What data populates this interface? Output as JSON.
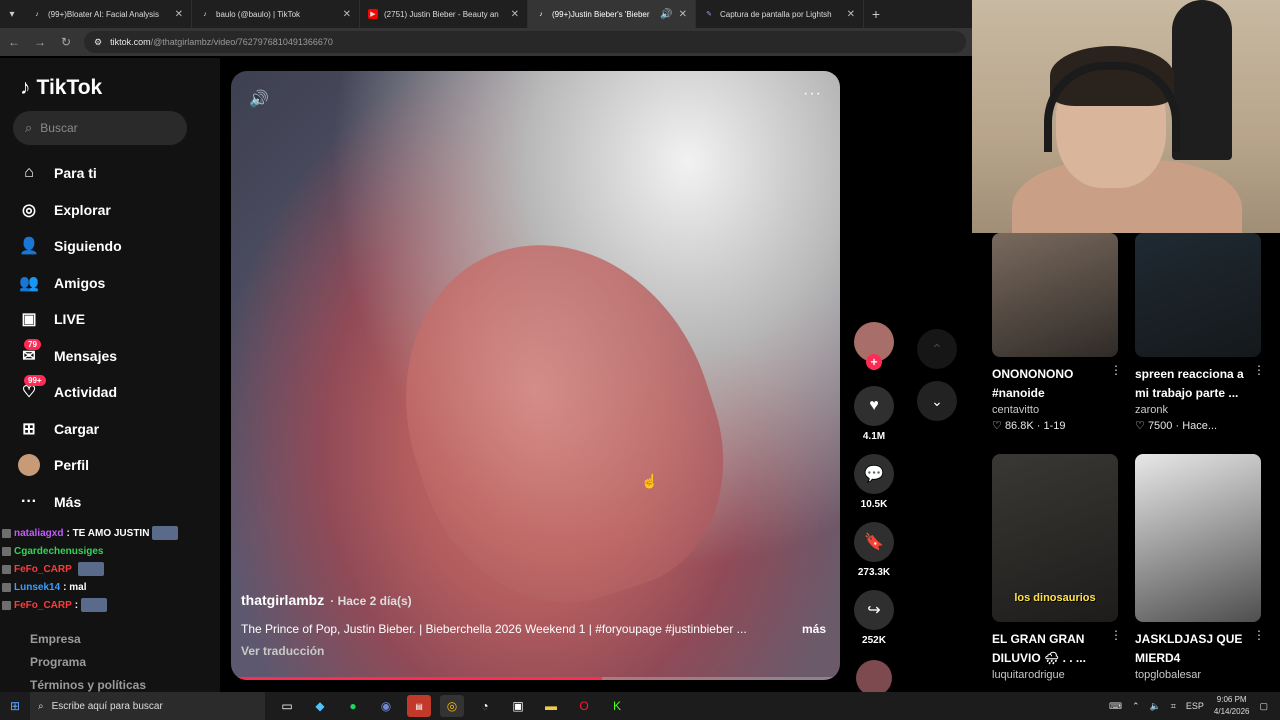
{
  "browser": {
    "tabs": [
      {
        "title": "(99+)Bloater AI: Facial Analysis",
        "favicon": "tiktok-icon",
        "active": false
      },
      {
        "title": "baulo (@baulo) | TikTok",
        "favicon": "tiktok-icon",
        "active": false
      },
      {
        "title": "(2751) Justin Bieber - Beauty an",
        "favicon": "youtube-icon",
        "active": false
      },
      {
        "title": "(99+)Justin Bieber's 'Bieber",
        "favicon": "tiktok-icon",
        "active": true
      },
      {
        "title": "Captura de pantalla por Lightsh",
        "favicon": "lightshot-icon",
        "active": false
      }
    ],
    "url_host": "tiktok.com",
    "url_path": "/@thatgirlambz/video/7627976810491366670"
  },
  "sidebar": {
    "logo": "TikTok",
    "search_placeholder": "Buscar",
    "nav": [
      {
        "label": "Para ti",
        "icon": "home-icon",
        "glyph": "⌂",
        "badge": ""
      },
      {
        "label": "Explorar",
        "icon": "compass-icon",
        "glyph": "◎",
        "badge": ""
      },
      {
        "label": "Siguiendo",
        "icon": "following-icon",
        "glyph": "👤",
        "badge": ""
      },
      {
        "label": "Amigos",
        "icon": "friends-icon",
        "glyph": "👥",
        "badge": ""
      },
      {
        "label": "LIVE",
        "icon": "live-icon",
        "glyph": "▣",
        "badge": ""
      },
      {
        "label": "Mensajes",
        "icon": "messages-icon",
        "glyph": "✉",
        "badge": "79"
      },
      {
        "label": "Actividad",
        "icon": "activity-icon",
        "glyph": "♡",
        "badge": "99+"
      },
      {
        "label": "Cargar",
        "icon": "upload-icon",
        "glyph": "⊞",
        "badge": ""
      },
      {
        "label": "Perfil",
        "icon": "profile-avatar",
        "glyph": "",
        "badge": ""
      },
      {
        "label": "Más",
        "icon": "more-icon",
        "glyph": "···",
        "badge": ""
      }
    ],
    "footer": [
      "Empresa",
      "Programa",
      "Términos y políticas"
    ]
  },
  "stream_chat": [
    {
      "user": "nataliagxd",
      "message": ": TE AMO JUSTIN"
    },
    {
      "user": "Cgardechenusiges",
      "message": ""
    },
    {
      "user": "FeFo_CARP",
      "message": ""
    },
    {
      "user": "Lunsek14",
      "message": ": mal"
    },
    {
      "user": "FeFo_CARP",
      "message": ":"
    }
  ],
  "video": {
    "author": "thatgirlambz",
    "posted": "Hace 2 día(s)",
    "description": "The Prince of Pop, Justin Bieber. | Bieberchella 2026 Weekend 1 | #foryoupage #justinbieber ...",
    "more_label": "más",
    "translate_label": "Ver traducción",
    "progress": 0.61,
    "likes": "4.1M",
    "comments": "10.5K",
    "saves": "273.3K",
    "shares": "252K"
  },
  "recommended": [
    {
      "title": "ONONONONO #nanoide",
      "author": "centavitto",
      "likes": "86.8K",
      "extra": "1-19",
      "thumb_color": "#7a6a5e"
    },
    {
      "title": "spreen reacciona a mi trabajo parte ...",
      "author": "zaronk",
      "likes": "7500",
      "extra": "Hace...",
      "thumb_color": "#1f2a33"
    },
    {
      "title": "EL GRAN GRAN DILUVIO 🌧 . . ...",
      "author": "luquitarodrigue",
      "likes": "",
      "extra": "",
      "thumb_color": "#3a3834",
      "overlay": "los dinosaurios"
    },
    {
      "title": "JASKLDJASJ QUE MIERD4",
      "author": "topglobalesar",
      "likes": "",
      "extra": "",
      "thumb_color": "#e8e8e8"
    }
  ],
  "taskbar": {
    "search_placeholder": "Escribe aquí para buscar",
    "lang": "ESP",
    "time": "9:06 PM",
    "date": "4/14/2026"
  },
  "colors": {
    "accent": "#fe2c55",
    "sidebar_bg": "#121212"
  }
}
